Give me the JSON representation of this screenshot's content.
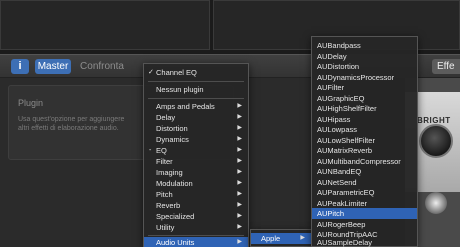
{
  "toolbar": {
    "info_label": "i",
    "master_label": "Master",
    "compare_label": "Confronta",
    "effects_label": "Effe"
  },
  "plugin": {
    "title": "Plugin",
    "description": "Usa quest'opzione per aggiungere altri effetti di elaborazione audio."
  },
  "amp": {
    "label": "BRIGHT"
  },
  "menu_main": {
    "items": [
      {
        "label": "Channel EQ",
        "checked": true
      },
      {
        "label": "Nessun plugin"
      },
      {
        "label": "Amps and Pedals",
        "submenu": true
      },
      {
        "label": "Delay",
        "submenu": true
      },
      {
        "label": "Distortion",
        "submenu": true
      },
      {
        "label": "Dynamics",
        "submenu": true
      },
      {
        "label": "EQ",
        "submenu": true,
        "dash": true
      },
      {
        "label": "Filter",
        "submenu": true
      },
      {
        "label": "Imaging",
        "submenu": true
      },
      {
        "label": "Modulation",
        "submenu": true
      },
      {
        "label": "Pitch",
        "submenu": true
      },
      {
        "label": "Reverb",
        "submenu": true
      },
      {
        "label": "Specialized",
        "submenu": true
      },
      {
        "label": "Utility",
        "submenu": true
      },
      {
        "label": "Audio Units",
        "submenu": true,
        "highlighted": true
      }
    ]
  },
  "menu_vendor": {
    "items": [
      {
        "label": "Apple",
        "submenu": true,
        "highlighted": true
      }
    ]
  },
  "menu_au": {
    "items": [
      {
        "label": "AUBandpass"
      },
      {
        "label": "AUDelay"
      },
      {
        "label": "AUDistortion"
      },
      {
        "label": "AUDynamicsProcessor"
      },
      {
        "label": "AUFilter"
      },
      {
        "label": "AUGraphicEQ"
      },
      {
        "label": "AUHighShelfFilter"
      },
      {
        "label": "AUHipass"
      },
      {
        "label": "AULowpass"
      },
      {
        "label": "AULowShelfFilter"
      },
      {
        "label": "AUMatrixReverb"
      },
      {
        "label": "AUMultibandCompressor"
      },
      {
        "label": "AUNBandEQ"
      },
      {
        "label": "AUNetSend"
      },
      {
        "label": "AUParametricEQ"
      },
      {
        "label": "AUPeakLimiter"
      },
      {
        "label": "AUPitch",
        "highlighted": true
      },
      {
        "label": "AURogerBeep"
      },
      {
        "label": "AURoundTripAAC"
      },
      {
        "label": "AUSampleDelay"
      }
    ]
  }
}
